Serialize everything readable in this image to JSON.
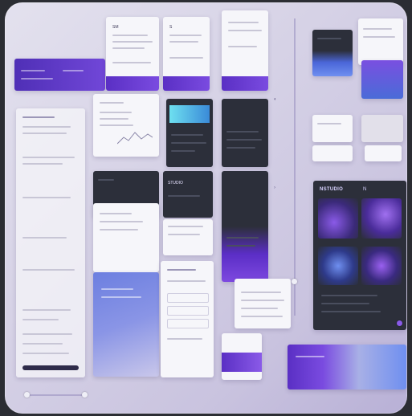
{
  "board": {
    "cards": {
      "c1": {
        "title": "SM",
        "lines": [
          "",
          ""
        ]
      },
      "c2": {
        "title": "S",
        "lines": [
          ""
        ]
      },
      "studio": {
        "title": "STUDIO"
      },
      "media": {
        "title": "NSTUDIO",
        "tag": "N"
      },
      "list": {
        "title": ""
      },
      "mini": {
        "title": ""
      }
    },
    "colors": {
      "accent": "#6f44d8",
      "accent_dark": "#4a2bb0",
      "panel_dark": "#2c2f3a",
      "blue": "#5f7de6"
    },
    "icons": [
      "toggle-icon",
      "chevron-icon",
      "star-icon",
      "tag-icon"
    ]
  }
}
